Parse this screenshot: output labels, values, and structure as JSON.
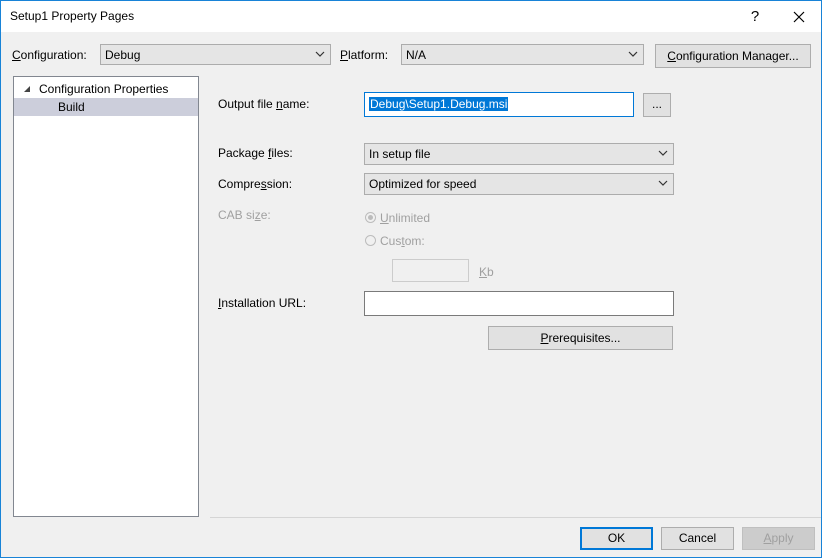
{
  "window": {
    "title": "Setup1 Property Pages",
    "help_label": "?",
    "close_label": "✕"
  },
  "top": {
    "configuration_label_prefix": "C",
    "configuration_label_rest": "onfiguration:",
    "configuration_value": "Debug",
    "platform_label_prefix": "P",
    "platform_label_rest": "latform:",
    "platform_value": "N/A",
    "config_manager_prefix": "C",
    "config_manager_rest": "onfiguration Manager..."
  },
  "tree": {
    "root_label": "Configuration Properties",
    "child_label": "Build"
  },
  "build": {
    "output_label_a": "Output file ",
    "output_label_u": "n",
    "output_label_b": "ame:",
    "output_value": "Debug\\Setup1.Debug.msi",
    "browse_label": "...",
    "package_label_a": "Package ",
    "package_label_u": "f",
    "package_label_b": "iles:",
    "package_value": "In setup file",
    "compression_label_a": "Compre",
    "compression_label_u": "s",
    "compression_label_b": "sion:",
    "compression_value": "Optimized for speed",
    "cab_label_a": "CAB si",
    "cab_label_u": "z",
    "cab_label_b": "e:",
    "unlimited_u": "U",
    "unlimited_rest": "nlimited",
    "custom_a": "Cus",
    "custom_u": "t",
    "custom_b": "om:",
    "kb_u": "K",
    "kb_rest": "b",
    "install_label_a": "",
    "install_label_u": "I",
    "install_label_b": "nstallation URL:",
    "prereq_u": "P",
    "prereq_rest": "rerequisites..."
  },
  "footer": {
    "ok_label": "OK",
    "cancel_label": "Cancel",
    "apply_u": "A",
    "apply_rest": "pply"
  }
}
